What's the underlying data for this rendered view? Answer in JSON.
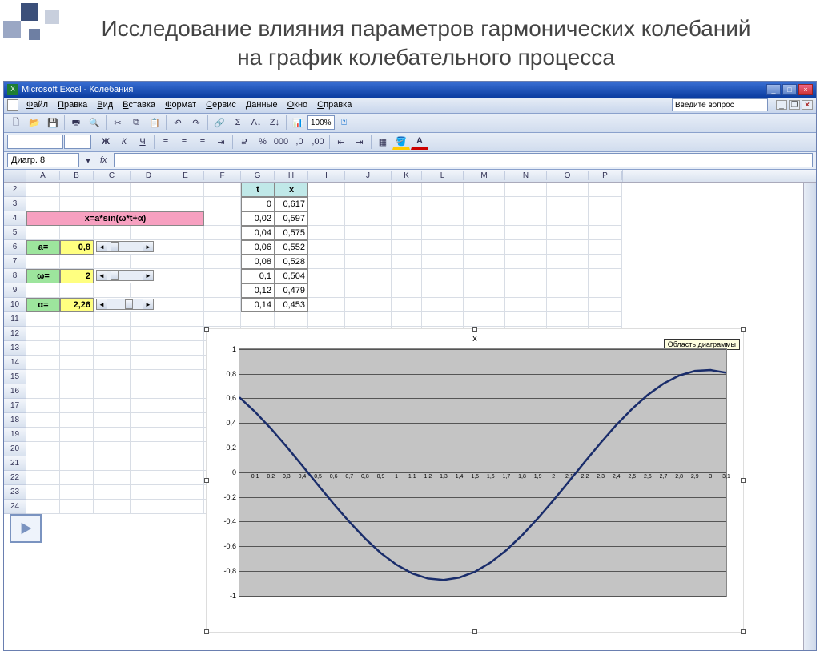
{
  "slide_title": "Исследование влияния параметров гармонических колебаний на график колебательного процесса",
  "titlebar": "Microsoft Excel - Колебания",
  "window_buttons": {
    "min": "_",
    "max": "□",
    "close": "×"
  },
  "menus": [
    "Файл",
    "Правка",
    "Вид",
    "Вставка",
    "Формат",
    "Сервис",
    "Данные",
    "Окно",
    "Справка"
  ],
  "help_placeholder": "Введите вопрос",
  "zoom": "100%",
  "namebox": "Диагр. 8",
  "columns": [
    "A",
    "B",
    "C",
    "D",
    "E",
    "F",
    "G",
    "H",
    "I",
    "J",
    "K",
    "L",
    "M",
    "N",
    "O",
    "P"
  ],
  "rows": [
    "2",
    "3",
    "4",
    "5",
    "6",
    "7",
    "8",
    "9",
    "10",
    "11",
    "12",
    "13",
    "14",
    "15",
    "16",
    "17",
    "18",
    "19",
    "20",
    "21",
    "22",
    "23",
    "24"
  ],
  "formula_cell": "x=a*sin(ω*t+α)",
  "params": {
    "a_label": "a=",
    "a_val": "0,8",
    "w_label": "ω=",
    "w_val": "2",
    "alpha_label": "α=",
    "alpha_val": "2,26"
  },
  "data_head": {
    "t": "t",
    "x": "x"
  },
  "data_rows": [
    [
      "0",
      "0,617"
    ],
    [
      "0,02",
      "0,597"
    ],
    [
      "0,04",
      "0,575"
    ],
    [
      "0,06",
      "0,552"
    ],
    [
      "0,08",
      "0,528"
    ],
    [
      "0,1",
      "0,504"
    ],
    [
      "0,12",
      "0,479"
    ],
    [
      "0,14",
      "0,453"
    ]
  ],
  "chart_title": "x",
  "chart_tooltip": "Область диаграммы",
  "chart_data": {
    "type": "line",
    "title": "x",
    "xlabel": "",
    "ylabel": "",
    "xlim": [
      0,
      3.1
    ],
    "ylim": [
      -1,
      1
    ],
    "y_ticks": [
      -1,
      -0.8,
      -0.6,
      -0.4,
      -0.2,
      0,
      0.2,
      0.4,
      0.6,
      0.8,
      1
    ],
    "y_tick_labels": [
      "-1",
      "-0,8",
      "-0,6",
      "-0,4",
      "-0,2",
      "0",
      "0,2",
      "0,4",
      "0,6",
      "0,8",
      "1"
    ],
    "x_ticks": [
      0.1,
      0.2,
      0.3,
      0.4,
      0.5,
      0.6,
      0.7,
      0.8,
      0.9,
      1,
      1.1,
      1.2,
      1.3,
      1.4,
      1.5,
      1.6,
      1.7,
      1.8,
      1.9,
      2,
      2.1,
      2.2,
      2.3,
      2.4,
      2.5,
      2.6,
      2.7,
      2.8,
      2.9,
      3,
      3.1
    ],
    "x_tick_labels": [
      "0,1",
      "0,2",
      "0,3",
      "0,4",
      "0,5",
      "0,6",
      "0,7",
      "0,8",
      "0,9",
      "1",
      "1,1",
      "1,2",
      "1,3",
      "1,4",
      "1,5",
      "1,6",
      "1,7",
      "1,8",
      "1,9",
      "2",
      "2,1",
      "2,2",
      "2,3",
      "2,4",
      "2,5",
      "2,6",
      "2,7",
      "2,8",
      "2,9",
      "3",
      "3,1"
    ],
    "series": [
      {
        "name": "x",
        "x": [
          0,
          0.1,
          0.2,
          0.3,
          0.4,
          0.5,
          0.6,
          0.7,
          0.8,
          0.9,
          1,
          1.1,
          1.2,
          1.3,
          1.4,
          1.5,
          1.6,
          1.7,
          1.8,
          1.9,
          2,
          2.1,
          2.2,
          2.3,
          2.4,
          2.5,
          2.6,
          2.7,
          2.8,
          2.9,
          3,
          3.1
        ],
        "values": [
          0.617,
          0.501,
          0.369,
          0.225,
          0.074,
          -0.08,
          -0.231,
          -0.374,
          -0.506,
          -0.621,
          -0.714,
          -0.783,
          -0.823,
          -0.835,
          -0.816,
          -0.77,
          -0.696,
          -0.598,
          -0.48,
          -0.346,
          -0.201,
          -0.049,
          0.105,
          0.255,
          0.397,
          0.525,
          0.636,
          0.726,
          0.79,
          0.827,
          0.834,
          0.813
        ]
      }
    ]
  }
}
